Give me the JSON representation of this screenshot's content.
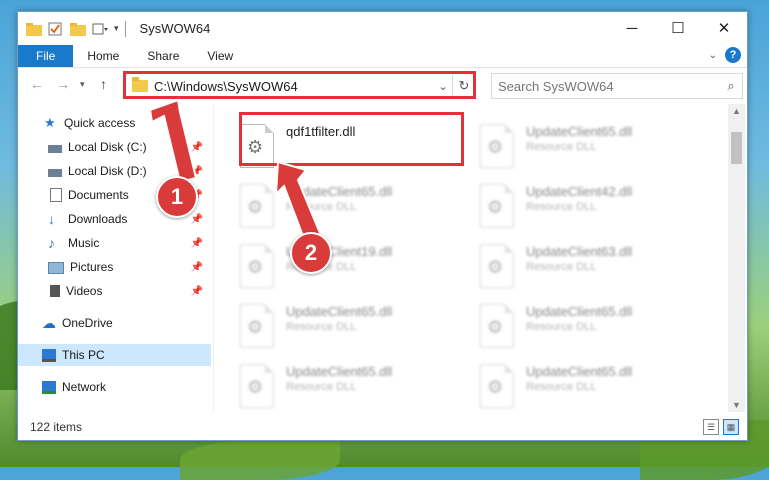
{
  "window": {
    "title": "SysWOW64"
  },
  "ribbon": {
    "tabs": [
      "File",
      "Home",
      "Share",
      "View"
    ],
    "help_label": "?"
  },
  "address": {
    "path": "C:\\Windows\\SysWOW64"
  },
  "search": {
    "placeholder": "Search SysWOW64"
  },
  "nav": {
    "items": [
      {
        "label": "Quick access",
        "pinned": false
      },
      {
        "label": "Local Disk (C:)",
        "pinned": true
      },
      {
        "label": "Local Disk (D:)",
        "pinned": true
      },
      {
        "label": "Documents",
        "pinned": true
      },
      {
        "label": "Downloads",
        "pinned": true
      },
      {
        "label": "Music",
        "pinned": true
      },
      {
        "label": "Pictures",
        "pinned": true
      },
      {
        "label": "Videos",
        "pinned": true
      },
      {
        "label": "OneDrive",
        "pinned": false
      },
      {
        "label": "This PC",
        "pinned": false,
        "selected": true
      },
      {
        "label": "Network",
        "pinned": false
      }
    ]
  },
  "files": [
    {
      "name": "qdf1tfilter.dll",
      "type": ""
    },
    {
      "name": "UpdateClient65.dll",
      "type": "Resource DLL"
    },
    {
      "name": "UpdateClient65.dll",
      "type": "Resource DLL"
    },
    {
      "name": "UpdateClient42.dll",
      "type": "Resource DLL"
    },
    {
      "name": "UpdateClient19.dll",
      "type": "Resource DLL"
    },
    {
      "name": "UpdateClient63.dll",
      "type": "Resource DLL"
    },
    {
      "name": "UpdateClient65.dll",
      "type": "Resource DLL"
    },
    {
      "name": "UpdateClient65.dll",
      "type": "Resource DLL"
    },
    {
      "name": "UpdateClient65.dll",
      "type": "Resource DLL"
    },
    {
      "name": "UpdateClient65.dll",
      "type": "Resource DLL"
    }
  ],
  "status": {
    "item_count": "122 items"
  },
  "annotations": {
    "step1": "1",
    "step2": "2"
  },
  "colors": {
    "accent": "#1979ca",
    "highlight": "#e0323a"
  }
}
